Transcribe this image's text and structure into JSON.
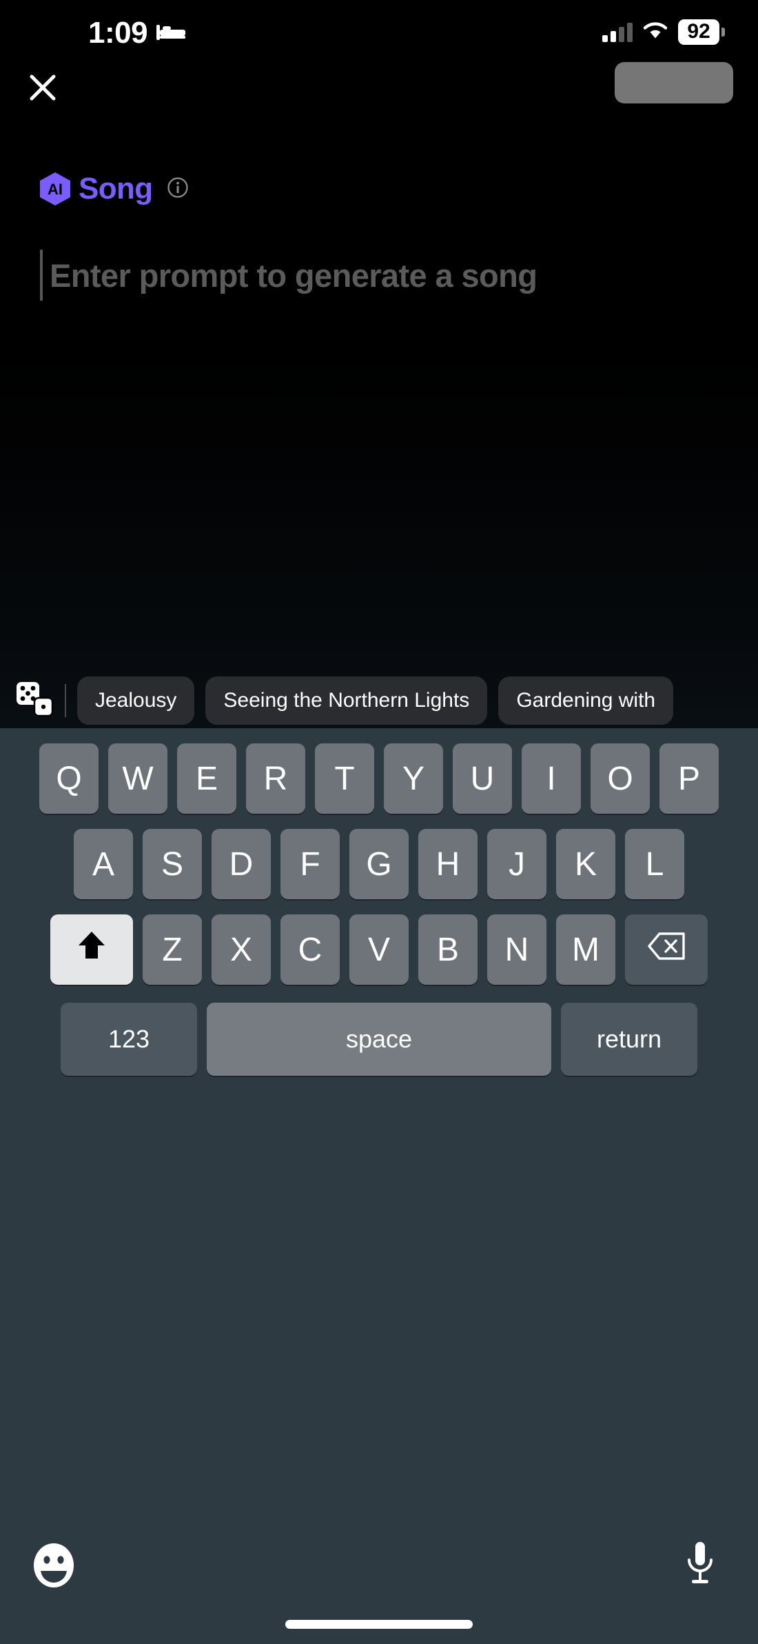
{
  "status_bar": {
    "time": "1:09",
    "focus_icon": "bed-icon",
    "signal_icon": "cellular-signal-icon",
    "wifi_icon": "wifi-icon",
    "battery_level": "92",
    "battery_icon": "battery-icon"
  },
  "nav": {
    "close_icon": "close-icon",
    "action_button_label": ""
  },
  "brand": {
    "badge_text": "AI",
    "title": "Song",
    "info_icon": "info-icon",
    "accent_color": "#7b5cff"
  },
  "prompt": {
    "value": "",
    "placeholder": "Enter prompt to generate a song"
  },
  "suggestions": {
    "shuffle_icon": "dice-icon",
    "chips": [
      {
        "label": "Jealousy"
      },
      {
        "label": "Seeing the Northern Lights"
      },
      {
        "label": "Gardening with"
      }
    ]
  },
  "keyboard": {
    "row1": [
      "Q",
      "W",
      "E",
      "R",
      "T",
      "Y",
      "U",
      "I",
      "O",
      "P"
    ],
    "row2": [
      "A",
      "S",
      "D",
      "F",
      "G",
      "H",
      "J",
      "K",
      "L"
    ],
    "row3": [
      "Z",
      "X",
      "C",
      "V",
      "B",
      "N",
      "M"
    ],
    "shift_icon": "shift-arrow-icon",
    "backspace_icon": "backspace-icon",
    "numbers_label": "123",
    "space_label": "space",
    "return_label": "return",
    "emoji_icon": "emoji-smiley-icon",
    "dictation_icon": "microphone-icon"
  }
}
